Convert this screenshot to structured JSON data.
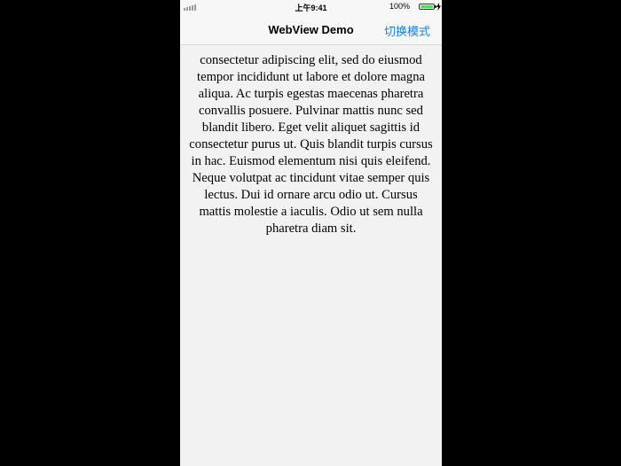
{
  "status_bar": {
    "time": "上午9:41",
    "battery_percent": "100%",
    "battery_level": 1.0
  },
  "nav": {
    "title": "WebView Demo",
    "action_label": "切换模式"
  },
  "web": {
    "body_text": "consectetur adipiscing elit, sed do eiusmod tempor incididunt ut labore et dolore magna aliqua. Ac turpis egestas maecenas pharetra convallis posuere. Pulvinar mattis nunc sed blandit libero. Eget velit aliquet sagittis id consectetur purus ut. Quis blandit turpis cursus in hac. Euismod elementum nisi quis eleifend. Neque volutpat ac tincidunt vitae semper quis lectus. Dui id ornare arcu odio ut. Cursus mattis molestie a iaculis. Odio ut sem nulla pharetra diam sit."
  },
  "colors": {
    "accent": "#1a7fe0",
    "background": "#f2f2f2",
    "battery": "#4cd964"
  }
}
